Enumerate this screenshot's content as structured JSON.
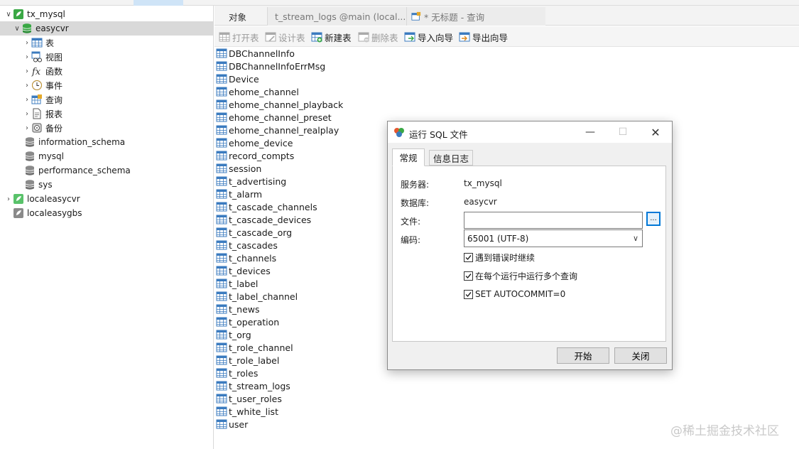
{
  "tree": {
    "connection": {
      "label": "tx_mysql",
      "expanded": true
    },
    "database": {
      "label": "easycvr",
      "expanded": true
    },
    "children": [
      {
        "label": "表",
        "icon": "table-icon"
      },
      {
        "label": "视图",
        "icon": "view-icon"
      },
      {
        "label": "函数",
        "icon": "function-icon"
      },
      {
        "label": "事件",
        "icon": "event-icon"
      },
      {
        "label": "查询",
        "icon": "query-icon"
      },
      {
        "label": "报表",
        "icon": "report-icon"
      },
      {
        "label": "备份",
        "icon": "backup-icon"
      }
    ],
    "other_databases": [
      "information_schema",
      "mysql",
      "performance_schema",
      "sys"
    ],
    "other_connections": [
      "localeasycvr",
      "localeasygbs"
    ]
  },
  "tabs": {
    "objects": "对象",
    "stream_logs": "t_stream_logs @main (local...",
    "untitled_query": "* 无标题 - 查询"
  },
  "toolbar": {
    "open_table": "打开表",
    "design_table": "设计表",
    "new_table": "新建表",
    "delete_table": "删除表",
    "import_wizard": "导入向导",
    "export_wizard": "导出向导"
  },
  "tables": [
    "DBChannelInfo",
    "DBChannelInfoErrMsg",
    "Device",
    "ehome_channel",
    "ehome_channel_playback",
    "ehome_channel_preset",
    "ehome_channel_realplay",
    "ehome_device",
    "record_compts",
    "session",
    "t_advertising",
    "t_alarm",
    "t_cascade_channels",
    "t_cascade_devices",
    "t_cascade_org",
    "t_cascades",
    "t_channels",
    "t_devices",
    "t_label",
    "t_label_channel",
    "t_news",
    "t_operation",
    "t_org",
    "t_role_channel",
    "t_role_label",
    "t_roles",
    "t_stream_logs",
    "t_user_roles",
    "t_white_list",
    "user"
  ],
  "dialog": {
    "title": "运行 SQL 文件",
    "tab_general": "常规",
    "tab_log": "信息日志",
    "server_label": "服务器:",
    "server_value": "tx_mysql",
    "database_label": "数据库:",
    "database_value": "easycvr",
    "file_label": "文件:",
    "file_value": "",
    "browse_label": "...",
    "encoding_label": "编码:",
    "encoding_value": "65001 (UTF-8)",
    "options": [
      {
        "label": "遇到错误时继续",
        "checked": true
      },
      {
        "label": "在每个运行中运行多个查询",
        "checked": true
      },
      {
        "label": "SET AUTOCOMMIT=0",
        "checked": true
      }
    ],
    "start_button": "开始",
    "close_button": "关闭"
  },
  "colors": {
    "accent": "#0078d7",
    "table_icon": "#3b7bbf",
    "connection_green": "#3aa845"
  },
  "watermark": "@稀土掘金技术社区"
}
